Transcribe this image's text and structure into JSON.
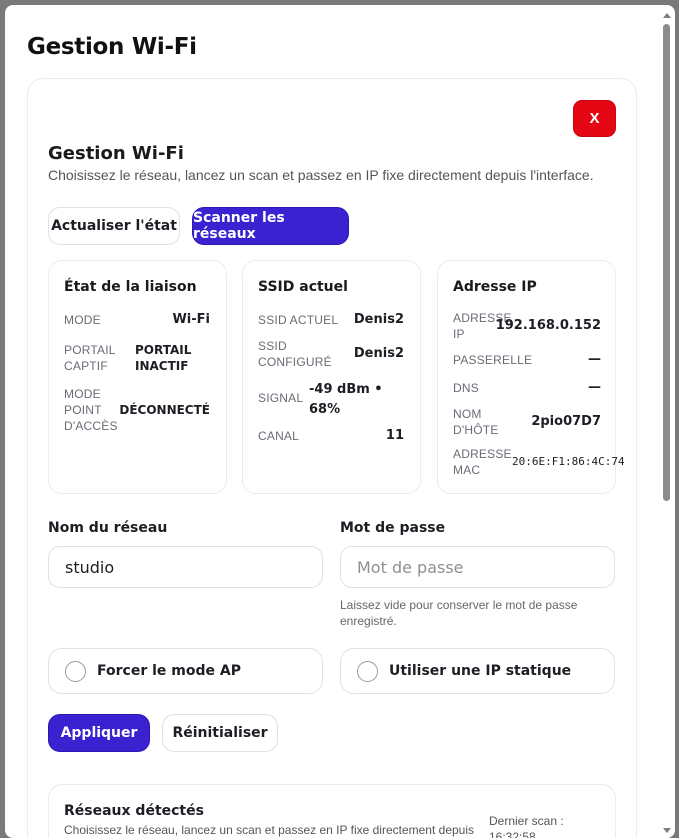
{
  "page": {
    "title": "Gestion Wi-Fi"
  },
  "panel": {
    "close_label": "X",
    "title": "Gestion Wi-Fi",
    "subtitle": "Choisissez le réseau, lancez un scan et passez en IP fixe directement depuis l'interface.",
    "refresh_label": "Actualiser l'état",
    "scan_label": "Scanner les réseaux"
  },
  "cards": {
    "link": {
      "title": "État de la liaison",
      "mode_label": "Mode",
      "mode_value": "Wi-Fi",
      "captive_label": "Portail captif",
      "captive_value": "Portail inactif",
      "ap_label": "Mode point d'accès",
      "ap_value": "Déconnecté"
    },
    "ssid": {
      "title": "SSID actuel",
      "current_label": "SSID actuel",
      "current_value": "Denis2",
      "configured_label": "SSID configuré",
      "configured_value": "Denis2",
      "signal_label": "Signal",
      "signal_value": "-49 dBm • 68%",
      "channel_label": "Canal",
      "channel_value": "11"
    },
    "ip": {
      "title": "Adresse IP",
      "ip_label": "Adresse IP",
      "ip_value": "192.168.0.152",
      "gateway_label": "Passerelle",
      "gateway_value": "—",
      "dns_label": "DNS",
      "dns_value": "—",
      "host_label": "Nom d'hôte",
      "host_value": "2pio07D7",
      "mac_label": "Adresse MAC",
      "mac_value": "20:6E:F1:86:4C:74"
    }
  },
  "form": {
    "ssid_label": "Nom du réseau",
    "ssid_value": "studio",
    "password_label": "Mot de passe",
    "password_placeholder": "Mot de passe",
    "password_hint": "Laissez vide pour conserver le mot de passe enregistré.",
    "force_ap_label": "Forcer le mode AP",
    "static_ip_label": "Utiliser une IP statique",
    "apply_label": "Appliquer",
    "reset_label": "Réinitialiser"
  },
  "networks": {
    "title": "Réseaux détectés",
    "subtitle": "Choisissez le réseau, lancez un scan et passez en IP fixe directement depuis",
    "last_scan": "Dernier scan : 16:32:58"
  },
  "colors": {
    "primary": "#3a22d0",
    "danger": "#e40613"
  }
}
